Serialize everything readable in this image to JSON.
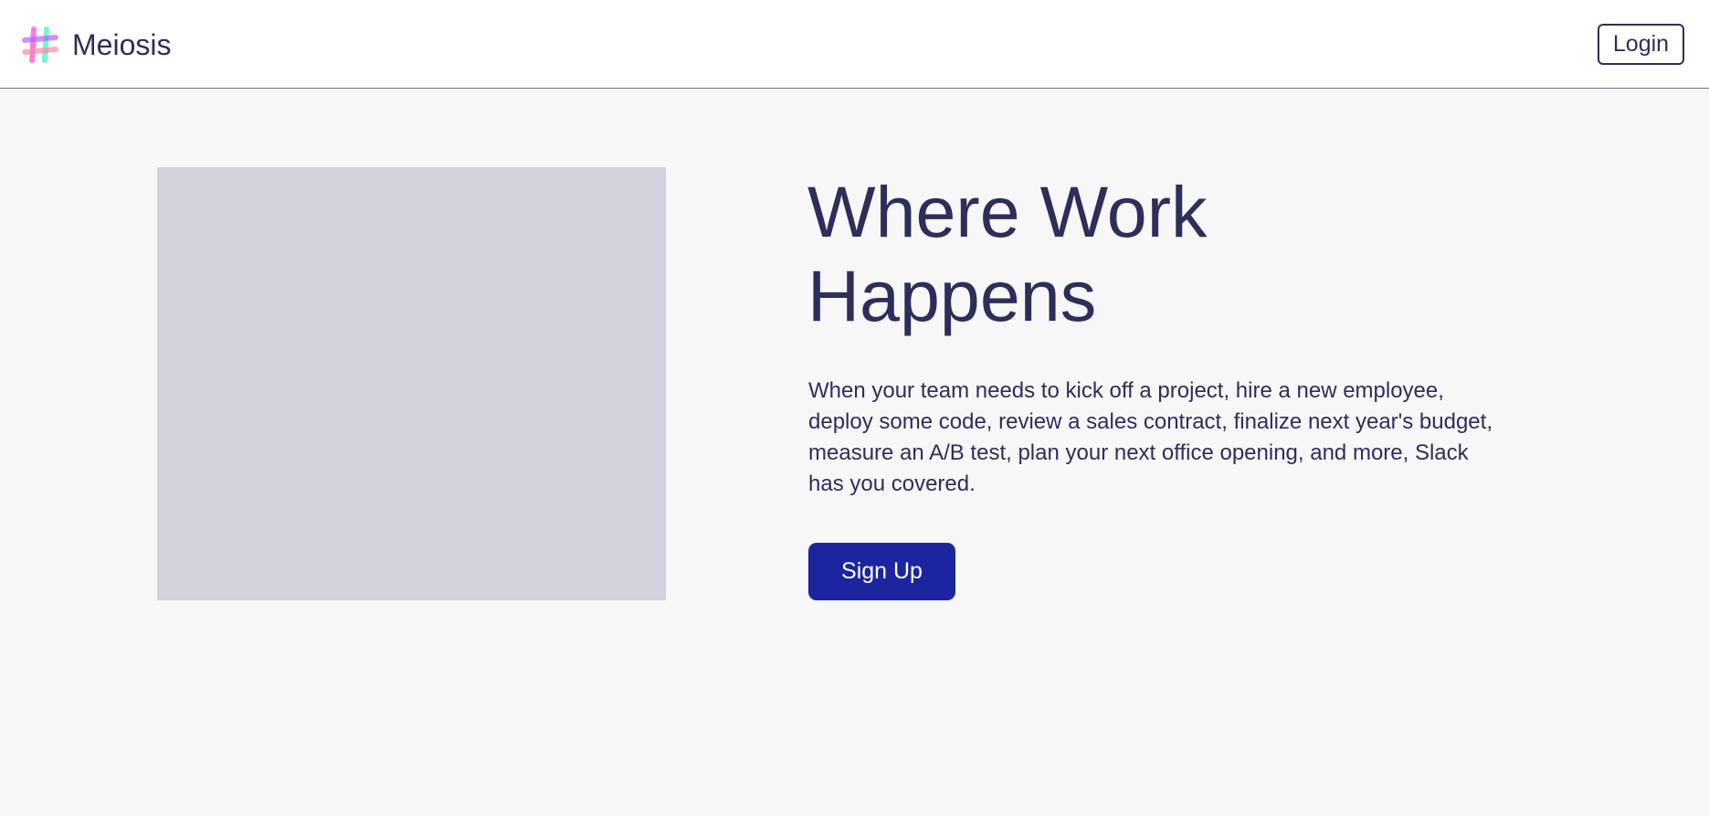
{
  "header": {
    "logo_icon": "hash-logo-icon",
    "brand_name": "Meiosis",
    "login_label": "Login"
  },
  "hero": {
    "image_placeholder_color": "#d1d1dc",
    "title": "Where Work Happens",
    "description": "When your team needs to kick off a project, hire a new employee, deploy some code, review a sales contract, finalize next year's budget, measure an A/B test, plan your next office opening, and more, Slack has you covered.",
    "signup_label": "Sign Up"
  },
  "colors": {
    "text": "#2d2f5a",
    "primary_button": "#1c259f",
    "page_background": "#f7f7f8",
    "header_background": "#ffffff"
  }
}
